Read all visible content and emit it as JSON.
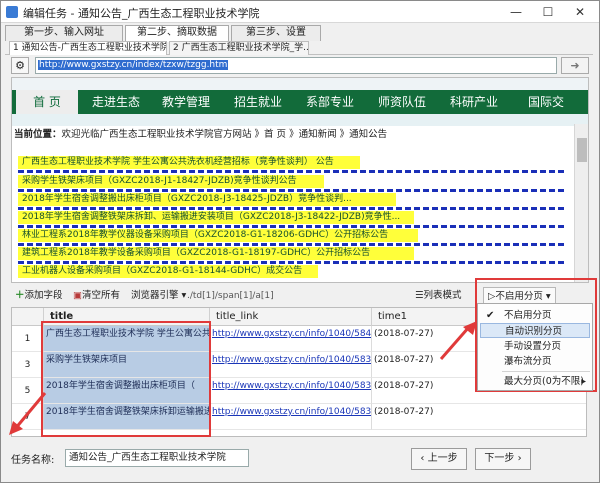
{
  "window": {
    "title": "编辑任务 - 通知公告_广西生态工程职业技术学院",
    "minimize": "—",
    "maximize": "☐",
    "close": "✕"
  },
  "steps": [
    "第一步、输入网址",
    "第二步、摘取数据",
    "第三步、设置"
  ],
  "page_tabs": [
    "1 通知公告-广西生态工程职业技术学院",
    "2 广西生态工程职业技术学院_学..."
  ],
  "url": "http://www.gxstzy.cn/index/tzxw/tzgg.htm",
  "site": {
    "nav": [
      "首 页",
      "走进生态",
      "教学管理",
      "招生就业",
      "系部专业",
      "师资队伍",
      "科研产业",
      "国际交"
    ],
    "breadcrumb_label": "当前位置：",
    "breadcrumb_text": "欢迎光临广西生态工程职业技术学院官方网站 》首 页 》通知新闻 》通知公告",
    "news": [
      "广西生态工程职业技术学院 学生公寓公共洗衣机经营招标（竞争性谈判） 公告",
      "采购学生铁架床项目（GXZC2018-J1-18427-JDZB)竞争性谈判公告",
      "2018年学生宿舍调整搬出床柜项目（GXZC2018-J3-18425-JDZB）竞争性谈判...",
      "2018年学生宿舍调整铁架床拆卸、运输搬进安装项目（GXZC2018-J3-18422-JDZB)竞争性...",
      "林业工程系2018年教学仪器设备采购项目（GXZC2018-G1-18206-GDHC）公开招标公告",
      "建筑工程系2018年教学设备采购项目（GXZC2018-G1-18197-GDHC）公开招标公告",
      "工业机器人设备采购项目（GXZC2018-G1-18144-GDHC）成交公告"
    ]
  },
  "toolbar": {
    "add_field": "添加字段",
    "clear_all": "清空所有",
    "browser_engine": "浏览器引擎",
    "xpath": "./td[1]/span[1]/a[1]",
    "list_mode": "列表模式",
    "paging": "不启用分页"
  },
  "grid": {
    "columns": [
      "title",
      "title_link",
      "time1"
    ],
    "rows": [
      {
        "idx": "1",
        "title": "广西生态工程职业技术学院 学生公寓公共",
        "link": "http://www.gxstzy.cn/info/1040/5841.htm",
        "time": "(2018-07-27)"
      },
      {
        "idx": "3",
        "title": "采购学生铁架床项目",
        "link": "http://www.gxstzy.cn/info/1040/5839.htm",
        "time": "(2018-07-27)"
      },
      {
        "idx": "5",
        "title": "2018年学生宿舍调整搬出床柜项目（",
        "link": "http://www.gxstzy.cn/info/1040/5838.htm",
        "time": "(2018-07-27)"
      },
      {
        "idx": "7",
        "title": "2018年学生宿舍调整铁架床拆卸运输搬进",
        "link": "http://www.gxstzy.cn/info/1040/5837.htm",
        "time": "(2018-07-27)"
      }
    ]
  },
  "paging_menu": [
    "不启用分页",
    "自动识别分页",
    "手动设置分页",
    "瀑布流分页",
    "最大分页(0为不限)"
  ],
  "bottom": {
    "task_label": "任务名称:",
    "task_name": "通知公告_广西生态工程职业技术学院",
    "prev": "上一步",
    "next": "下一步"
  },
  "colors": {
    "nav_green": "#126b3a",
    "highlight_yellow": "#ffff3a",
    "selection_blue": "#b8cce4",
    "annotation_red": "#e03a3a"
  }
}
